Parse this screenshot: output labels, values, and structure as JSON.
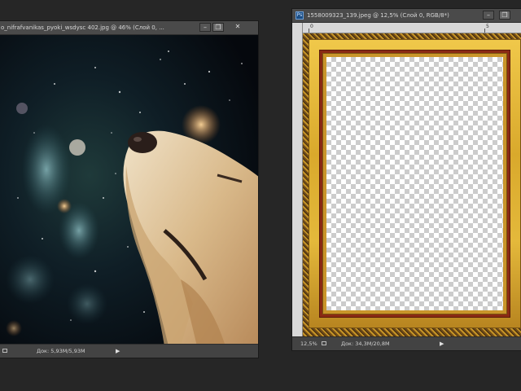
{
  "left_window": {
    "title": "o_nifrafvanikas_pyoki_wsdysc 402.jpg @ 46% (Слой 0, ...",
    "status_zoom": "",
    "status_doc": "Док: 5,93М/5,93М",
    "status_arrow": "▶"
  },
  "right_window": {
    "ps_icon": "Ps",
    "title": "1558009323_139.jpeg @ 12,5% (Слой 0, RGB/8*)",
    "ruler_ticks": [
      "0",
      "5"
    ],
    "status_zoom": "12,5%",
    "status_doc": "Док: 34,3М/20,8М",
    "status_arrow": "▶"
  },
  "window_buttons": {
    "minimize": "–",
    "restore": "❐",
    "close": "✕"
  },
  "colors": {
    "workspace": "#262626",
    "frame_gold": "#e4b93b",
    "frame_red": "#8a2a14"
  }
}
